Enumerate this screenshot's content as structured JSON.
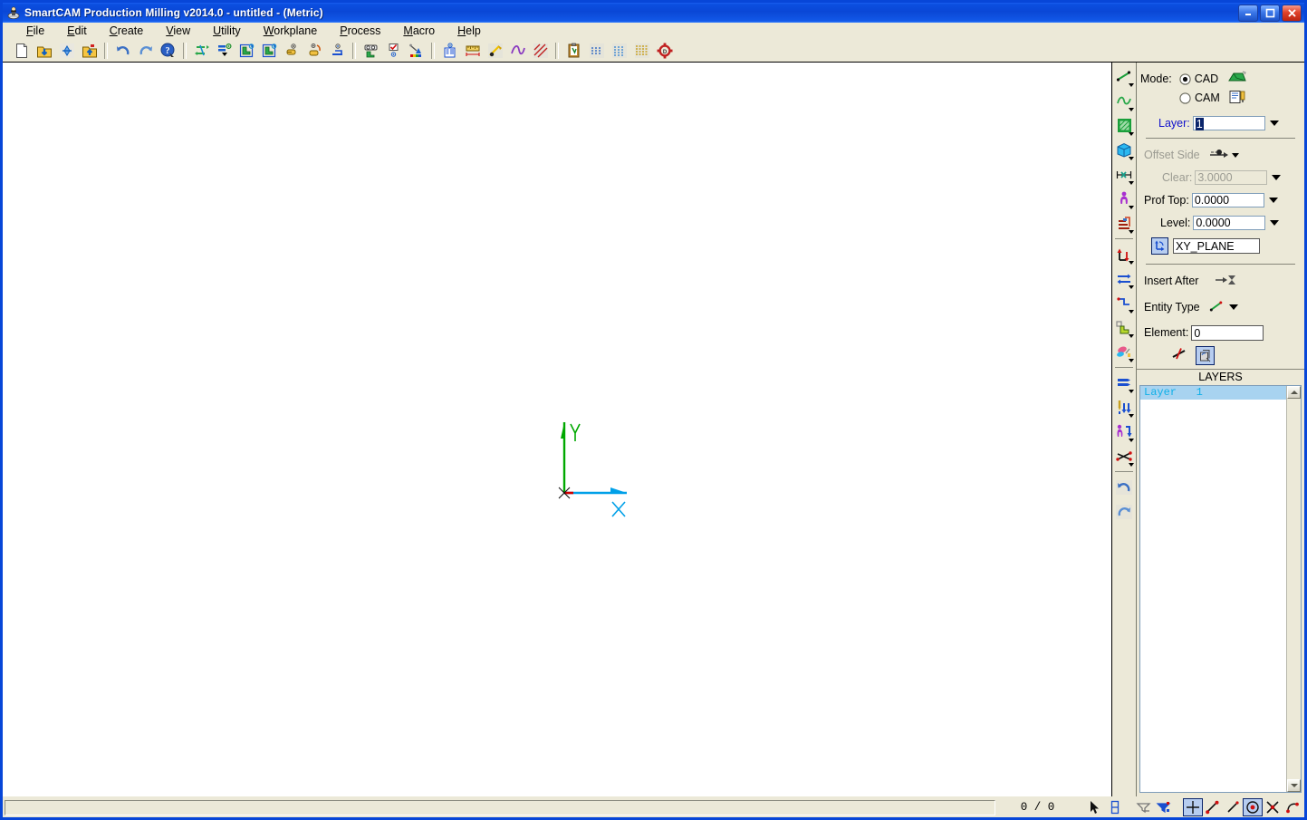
{
  "window": {
    "title": "SmartCAM Production Milling v2014.0 - untitled - (Metric)",
    "icon": "smartcam-app-icon",
    "buttons": {
      "minimize": "minimize-button",
      "maximize": "maximize-button",
      "close": "close-button"
    }
  },
  "menubar": {
    "items": [
      {
        "label": "File",
        "accel": "F"
      },
      {
        "label": "Edit",
        "accel": "E"
      },
      {
        "label": "Create",
        "accel": "C"
      },
      {
        "label": "View",
        "accel": "V"
      },
      {
        "label": "Utility",
        "accel": "U"
      },
      {
        "label": "Workplane",
        "accel": "W"
      },
      {
        "label": "Process",
        "accel": "P"
      },
      {
        "label": "Macro",
        "accel": "M"
      },
      {
        "label": "Help",
        "accel": "H"
      }
    ]
  },
  "toolbar": {
    "groups": [
      [
        "new-file-icon",
        "open-file-icon",
        "merge-file-icon",
        "save-file-icon"
      ],
      [
        "undo-icon",
        "redo-icon",
        "help-cursor-icon"
      ],
      [
        "regenerate-icon",
        "list-order-icon",
        "show-layer-icon",
        "hide-layer-icon",
        "view-window-icon",
        "view-rotate-icon",
        "view-extents-icon"
      ],
      [
        "verify-icon",
        "check-geometry-icon",
        "color-paint-icon"
      ],
      [
        "layout-report-icon",
        "measure-icon",
        "trim-icon",
        "fillet-icon",
        "hatch-icon"
      ],
      [
        "clipboard-icon",
        "process-1-icon",
        "process-2-icon",
        "process-3-icon",
        "settings-gear-icon"
      ]
    ]
  },
  "canvas": {
    "axis": {
      "y_label": "Y",
      "x_label": "X",
      "y_color": "#00a800",
      "x_color": "#00a0e8",
      "origin_color": "#d00000"
    }
  },
  "vertical_toolbar": {
    "items": [
      "create-line-icon",
      "create-spline-icon",
      "create-surface-icon",
      "create-solid-icon",
      "dimension-icon",
      "figure-icon",
      "assembly-icon",
      "move-copy-icon",
      "mirror-icon",
      "transform-icon",
      "shape-edit-icon",
      "paint-color-icon",
      "list-edit-icon",
      "drill-process-icon",
      "profile-process-icon",
      "pocket-process-icon",
      "zoom-in-icon",
      "zoom-out-icon"
    ]
  },
  "right_panel": {
    "mode": {
      "label": "Mode:",
      "options": [
        {
          "label": "CAD",
          "selected": true,
          "icon": "cad-mode-icon"
        },
        {
          "label": "CAM",
          "selected": false,
          "icon": "cam-mode-icon"
        }
      ]
    },
    "layer": {
      "label": "Layer:",
      "value": "1",
      "dropdown": "layer-dropdown-arrow"
    },
    "offset_side": {
      "label": "Offset Side",
      "disabled": true,
      "icon": "offset-side-icon"
    },
    "clear": {
      "label": "Clear:",
      "value": "3.0000",
      "disabled": true
    },
    "prof_top": {
      "label": "Prof Top:",
      "value": "0.0000"
    },
    "level": {
      "label": "Level:",
      "value": "0.0000"
    },
    "workplane": {
      "icon": "workplane-axes-icon",
      "value": "XY_PLANE"
    },
    "insert_after": {
      "label": "Insert After",
      "icon": "insert-after-icon"
    },
    "entity_type": {
      "label": "Entity Type",
      "icon": "entity-type-line-icon",
      "dropdown": "entity-type-dropdown-arrow"
    },
    "element": {
      "label": "Element:",
      "value": "0"
    },
    "element_buttons": [
      "not-equal-icon",
      "copy-entity-icon"
    ]
  },
  "layers": {
    "header": "LAYERS",
    "items": [
      {
        "label": "Layer   1",
        "selected": true
      }
    ],
    "scrollbar": {
      "up": "scroll-up-arrow",
      "down": "scroll-down-arrow"
    }
  },
  "statusbar": {
    "message": "",
    "count": "0 / 0",
    "icons": [
      {
        "name": "pointer-icon",
        "pressed": false
      },
      {
        "name": "snap-toggle-icon",
        "pressed": false
      },
      {
        "name": "filter-off-icon",
        "pressed": false
      },
      {
        "name": "filter-on-icon",
        "pressed": false
      },
      {
        "name": "snap-crosshair-icon",
        "pressed": true
      },
      {
        "name": "snap-endpoint-icon",
        "pressed": false
      },
      {
        "name": "snap-midpoint-icon",
        "pressed": false
      },
      {
        "name": "snap-center-icon",
        "pressed": true
      },
      {
        "name": "snap-intersection-icon",
        "pressed": false
      },
      {
        "name": "snap-tangent-icon",
        "pressed": false
      }
    ]
  },
  "colors": {
    "titlebar": "#0a47d6",
    "panel": "#ece9d8",
    "canvas": "#ffffff",
    "frame": "#0746d8",
    "label_blue": "#1111cc",
    "disabled": "#9b9b92"
  }
}
